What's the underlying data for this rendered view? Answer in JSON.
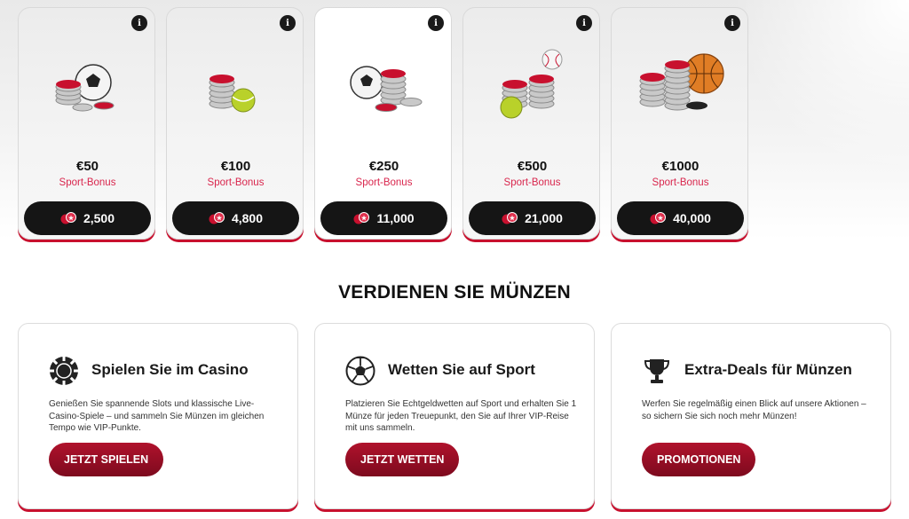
{
  "rewards": [
    {
      "amount": "€50",
      "label": "Sport-Bonus",
      "coins": "2,500",
      "info": "i"
    },
    {
      "amount": "€100",
      "label": "Sport-Bonus",
      "coins": "4,800",
      "info": "i"
    },
    {
      "amount": "€250",
      "label": "Sport-Bonus",
      "coins": "11,000",
      "info": "i"
    },
    {
      "amount": "€500",
      "label": "Sport-Bonus",
      "coins": "21,000",
      "info": "i"
    },
    {
      "amount": "€1000",
      "label": "Sport-Bonus",
      "coins": "40,000",
      "info": "i"
    }
  ],
  "section_title": "VERDIENEN SIE MÜNZEN",
  "earn": [
    {
      "title": "Spielen Sie im Casino",
      "text": "Genießen Sie spannende Slots und klassische Live-Casino-Spiele – und sammeln Sie Münzen im gleichen Tempo wie VIP-Punkte.",
      "button": "JETZT SPIELEN",
      "icon": "casino-chip-icon"
    },
    {
      "title": "Wetten Sie auf Sport",
      "text": "Platzieren Sie Echtgeldwetten auf Sport und erhalten Sie 1 Münze für jeden Treuepunkt, den Sie auf Ihrer VIP-Reise mit uns sammeln.",
      "button": "JETZT WETTEN",
      "icon": "soccer-ball-icon"
    },
    {
      "title": "Extra-Deals für Münzen",
      "text": "Werfen Sie regelmäßig einen Blick auf unsere Aktionen – so sichern Sie sich noch mehr Münzen!",
      "button": "PROMOTIONEN",
      "icon": "trophy-icon"
    }
  ],
  "colors": {
    "accent": "#c8102e",
    "bonus_text": "#d9264d",
    "dark": "#151515"
  }
}
